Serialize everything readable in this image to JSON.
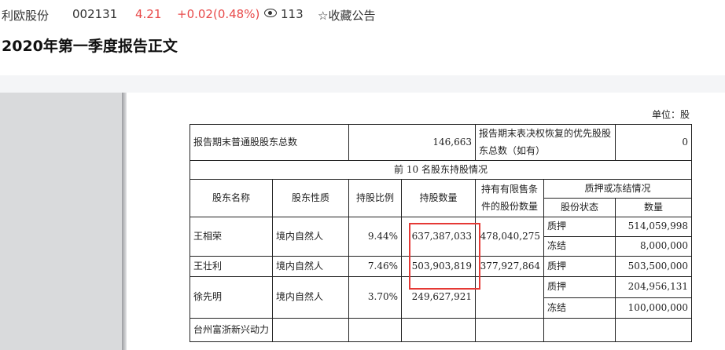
{
  "ticker": {
    "name": "利欧股份",
    "code": "002131",
    "price": "4.21",
    "change": "+0.02(0.48%)",
    "views": "113",
    "favorite_label": "☆收藏公告"
  },
  "doc_title": "2020年第一季度报告正文",
  "unit": "单位：股",
  "table": {
    "total_label": "报告期末普通股股东总数",
    "total_value": "146,663",
    "pref_label": "报告期末表决权恢复的优先股股东总数（如有）",
    "pref_value": "0",
    "section_title": "前 10 名股东持股情况",
    "headers": {
      "name": "股东名称",
      "nature": "股东性质",
      "ratio": "持股比例",
      "quantity": "持股数量",
      "restricted": "持有有限售条件的股份数量",
      "pledge_group": "质押或冻结情况",
      "share_status": "股份状态",
      "amount": "数量"
    },
    "rows": [
      {
        "name": "王相荣",
        "nature": "境内自然人",
        "ratio": "9.44%",
        "quantity": "637,387,033",
        "restricted": "478,040,275",
        "s1": "质押",
        "a1": "514,059,998",
        "s2": "冻结",
        "a2": "8,000,000"
      },
      {
        "name": "王壮利",
        "nature": "境内自然人",
        "ratio": "7.46%",
        "quantity": "503,903,819",
        "restricted": "377,927,864",
        "s1": "质押",
        "a1": "503,500,000"
      },
      {
        "name": "徐先明",
        "nature": "境内自然人",
        "ratio": "3.70%",
        "quantity": "249,627,921",
        "restricted": "",
        "s1": "质押",
        "a1": "204,956,131",
        "s2": "冻结",
        "a2": "100,000,000"
      },
      {
        "name": "台州富浙新兴动力"
      }
    ]
  }
}
